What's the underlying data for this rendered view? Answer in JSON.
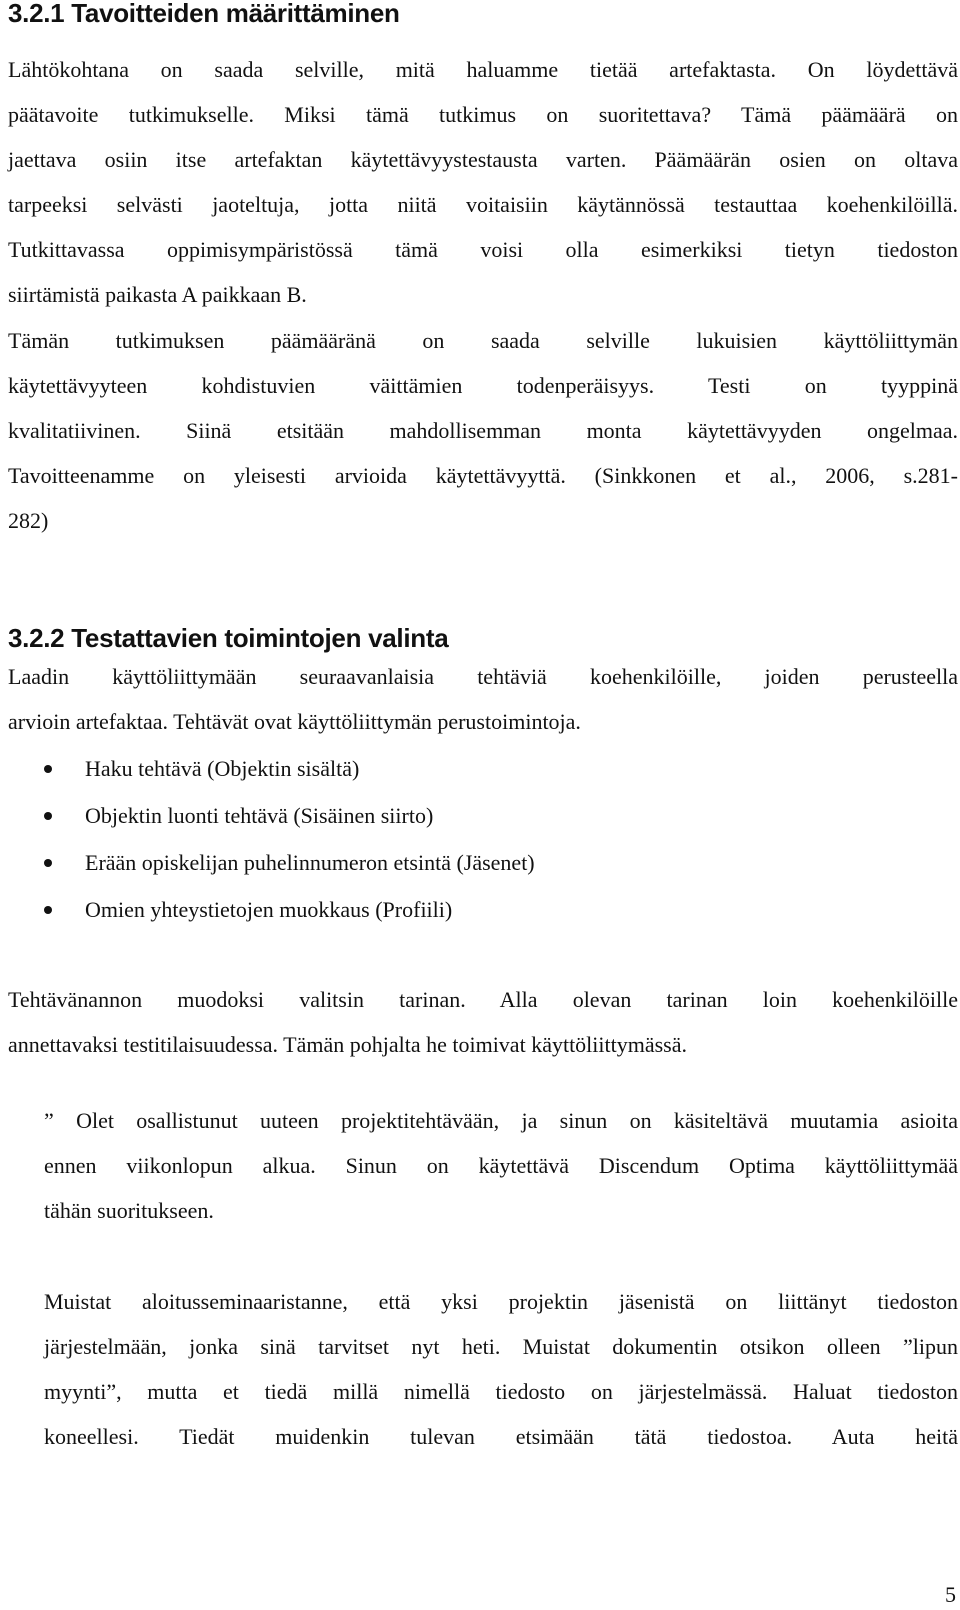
{
  "section1": {
    "heading": "3.2.1 Tavoitteiden määrittäminen",
    "lines": [
      "Lähtökohtana on saada selville, mitä haluamme tietää artefaktasta. On löydettävä",
      "päätavoite tutkimukselle. Miksi tämä tutkimus on suoritettava? Tämä päämäärä on",
      "jaettava osiin itse artefaktan käytettävyystestausta varten. Päämäärän osien on oltava",
      "tarpeeksi selvästi jaoteltuja, jotta niitä voitaisiin käytännössä testauttaa koehenkilöillä.",
      "Tutkittavassa oppimisympäristössä tämä voisi olla esimerkiksi tietyn tiedoston",
      "siirtämistä paikasta A paikkaan B.",
      "Tämän tutkimuksen päämääränä on saada selville lukuisien käyttöliittymän",
      "käytettävyyteen kohdistuvien väittämien todenperäisyys. Testi on tyyppinä",
      "kvalitatiivinen. Siinä etsitään mahdollisemman monta käytettävyyden ongelmaa.",
      "Tavoitteenamme on yleisesti arvioida käytettävyyttä. (Sinkkonen et al., 2006, s.281-",
      "282)"
    ]
  },
  "section2": {
    "heading": "3.2.2 Testattavien toimintojen valinta",
    "intro_lines": [
      "Laadin käyttöliittymään seuraavanlaisia tehtäviä koehenkilöille, joiden perusteella",
      "arvioin artefaktaa. Tehtävät ovat käyttöliittymän perustoimintoja."
    ],
    "bullets": [
      "Haku tehtävä (Objektin sisältä)",
      "Objektin luonti tehtävä (Sisäinen siirto)",
      "Erään opiskelijan puhelinnumeron etsintä (Jäsenet)",
      "Omien yhteystietojen muokkaus (Profiili)"
    ],
    "para_lines": [
      "Tehtävänannon muodoksi valitsin tarinan. Alla olevan tarinan loin koehenkilöille",
      "annettavaksi testitilaisuudessa. Tämän pohjalta he toimivat käyttöliittymässä."
    ],
    "story1_lines": [
      "” Olet osallistunut uuteen projektitehtävään, ja sinun on käsiteltävä muutamia asioita",
      "ennen viikonlopun alkua.  Sinun on käytettävä Discendum Optima käyttöliittymää",
      "tähän suoritukseen."
    ],
    "story2_lines": [
      "Muistat aloitusseminaaristanne, että yksi projektin jäsenistä on liittänyt tiedoston",
      "järjestelmään, jonka sinä tarvitset nyt heti. Muistat dokumentin otsikon olleen ”lipun",
      "myynti”, mutta et tiedä millä nimellä tiedosto on järjestelmässä. Haluat tiedoston",
      "koneellesi. Tiedät muidenkin tulevan etsimään tätä tiedostoa. Auta heitä"
    ]
  },
  "page_number": "5"
}
